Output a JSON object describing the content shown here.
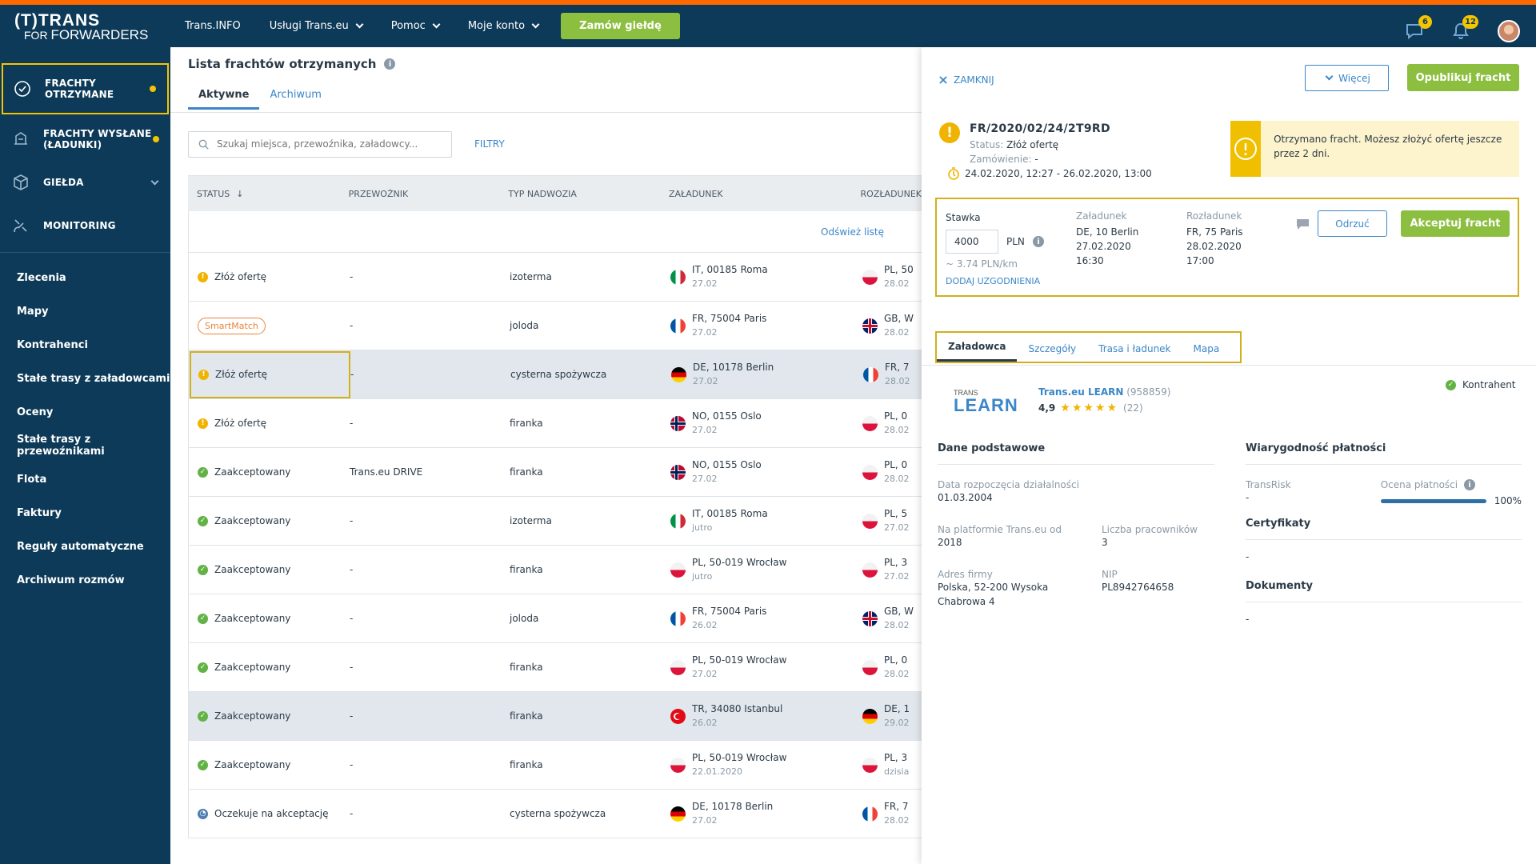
{
  "brand": {
    "line1": "(T)TRANS",
    "line2a": "FOR ",
    "line2b": "FORWARDERS"
  },
  "nav": {
    "items": [
      "Trans.INFO",
      "Usługi Trans.eu",
      "Pomoc",
      "Moje konto"
    ],
    "order_button": "Zamów giełdę"
  },
  "top_right": {
    "messages_count": "6",
    "notifications_count": "12"
  },
  "sidebar": {
    "main": [
      {
        "label1": "FRACHTY",
        "label2": "OTRZYMANE",
        "icon": "freight-received-icon"
      },
      {
        "label1": "FRACHTY WYSŁANE",
        "label2": "(ŁADUNKI)",
        "icon": "freight-sent-icon"
      },
      {
        "label1": "GIEŁDA",
        "label2": "",
        "icon": "box-icon"
      },
      {
        "label1": "MONITORING",
        "label2": "",
        "icon": "satellite-icon"
      }
    ],
    "links": [
      "Zlecenia",
      "Mapy",
      "Kontrahenci",
      "Stałe trasy z załadowcami",
      "Oceny",
      "Stałe trasy z przewoźnikami",
      "Flota",
      "Faktury",
      "Reguły automatyczne",
      "Archiwum rozmów"
    ]
  },
  "list": {
    "title": "Lista frachtów otrzymanych",
    "tabs": [
      "Aktywne",
      "Archiwum"
    ],
    "search_placeholder": "Szukaj miejsca, przewoźnika, załadowcy...",
    "filters": "FILTRY",
    "columns": [
      "STATUS",
      "PRZEWOŹNIK",
      "TYP NADWOZIA",
      "ZAŁADUNEK",
      "ROZŁADUNEK"
    ],
    "refresh": "Odśwież listę",
    "rows": [
      {
        "status": "Złóż ofertę",
        "kind": "warn",
        "carrier": "-",
        "body": "izoterma",
        "from_flag": "it",
        "from": "IT, 00185 Roma",
        "from_date": "27.02",
        "to_flag": "pl",
        "to": "PL, 50",
        "to_date": "28.02"
      },
      {
        "status": "SmartMatch",
        "kind": "smart",
        "carrier": "-",
        "body": "joloda",
        "from_flag": "fr",
        "from": "FR, 75004 Paris",
        "from_date": "27.02",
        "to_flag": "gb",
        "to": "GB, W",
        "to_date": "28.02"
      },
      {
        "status": "Złóż ofertę",
        "kind": "warn",
        "carrier": "-",
        "body": "cysterna spożywcza",
        "from_flag": "de",
        "from": "DE, 10178 Berlin",
        "from_date": "27.02",
        "to_flag": "fr",
        "to": "FR, 7",
        "to_date": "28.02"
      },
      {
        "status": "Złóż ofertę",
        "kind": "warn",
        "carrier": "-",
        "body": "firanka",
        "from_flag": "no",
        "from": "NO, 0155 Oslo",
        "from_date": "27.02",
        "to_flag": "pl",
        "to": "PL, 0",
        "to_date": "28.02"
      },
      {
        "status": "Zaakceptowany",
        "kind": "ok",
        "carrier": "Trans.eu DRIVE",
        "body": "firanka",
        "from_flag": "no",
        "from": "NO, 0155 Oslo",
        "from_date": "27.02",
        "to_flag": "pl",
        "to": "PL, 0",
        "to_date": "28.02"
      },
      {
        "status": "Zaakceptowany",
        "kind": "ok",
        "carrier": "-",
        "body": "izoterma",
        "from_flag": "it",
        "from": "IT, 00185 Roma",
        "from_date": "jutro",
        "to_flag": "pl",
        "to": "PL, 5",
        "to_date": "27.02"
      },
      {
        "status": "Zaakceptowany",
        "kind": "ok",
        "carrier": "-",
        "body": "firanka",
        "from_flag": "pl",
        "from": "PL, 50-019 Wrocław",
        "from_date": "jutro",
        "to_flag": "pl",
        "to": "PL, 3",
        "to_date": "27.02"
      },
      {
        "status": "Zaakceptowany",
        "kind": "ok",
        "carrier": "-",
        "body": "joloda",
        "from_flag": "fr",
        "from": "FR, 75004 Paris",
        "from_date": "26.02",
        "to_flag": "gb",
        "to": "GB, W",
        "to_date": "28.02"
      },
      {
        "status": "Zaakceptowany",
        "kind": "ok",
        "carrier": "-",
        "body": "firanka",
        "from_flag": "pl",
        "from": "PL, 50-019 Wrocław",
        "from_date": "27.02",
        "to_flag": "pl",
        "to": "PL, 0",
        "to_date": "28.02"
      },
      {
        "status": "Zaakceptowany",
        "kind": "ok",
        "carrier": "-",
        "body": "firanka",
        "from_flag": "tr",
        "from": "TR, 34080 Istanbul",
        "from_date": "26.02",
        "to_flag": "de",
        "to": "DE, 1",
        "to_date": "29.02"
      },
      {
        "status": "Zaakceptowany",
        "kind": "ok",
        "carrier": "-",
        "body": "firanka",
        "from_flag": "pl",
        "from": "PL, 50-019 Wrocław",
        "from_date": "22.01.2020",
        "to_flag": "pl",
        "to": "PL, 3",
        "to_date": "dzisia"
      },
      {
        "status": "Oczekuje na akceptację",
        "kind": "clock",
        "carrier": "-",
        "body": "cysterna spożywcza",
        "from_flag": "de",
        "from": "DE, 10178 Berlin",
        "from_date": "27.02",
        "to_flag": "fr",
        "to": "FR, 7",
        "to_date": "28.02"
      }
    ]
  },
  "panel": {
    "close": "ZAMKNIJ",
    "more": "Więcej",
    "publish": "Opublikuj fracht",
    "id": "FR/2020/02/24/2T9RD",
    "status_label": "Status:",
    "status_value": "Złóż ofertę",
    "order_label": "Zamówienie:",
    "order_value": "-",
    "dates": "24.02.2020, 12:27 - 26.02.2020, 13:00",
    "notice": "Otrzymano fracht. Możesz złożyć ofertę jeszcze przez 2 dni.",
    "offer": {
      "rate_label": "Stawka",
      "rate_value": "4000",
      "currency": "PLN",
      "per_km": "~ 3.74 PLN/km",
      "add": "DODAJ UZGODNIENIA",
      "load_label": "Załadunek",
      "load_l1": "DE, 10 Berlin",
      "load_l2": "27.02.2020",
      "load_l3": "16:30",
      "unload_label": "Rozładunek",
      "unload_l1": "FR, 75 Paris",
      "unload_l2": "28.02.2020",
      "unload_l3": "17:00",
      "reject": "Odrzuć",
      "accept": "Akceptuj fracht"
    },
    "tabs": [
      "Załadowca",
      "Szczegóły",
      "Trasa i ładunek",
      "Mapa"
    ],
    "logo_small": "TRANS",
    "logo_big": "LEARN",
    "company_name": "Trans.eu LEARN",
    "company_id": "(958859)",
    "rating": "4,9",
    "stars": "★★★★★",
    "reviews": "(22)",
    "kontrahent": "Kontrahent",
    "basic": {
      "title": "Dane podstawowe",
      "start_label": "Data rozpoczęcia działalności",
      "start_value": "01.03.2004",
      "since_label": "Na platformie Trans.eu od",
      "since_value": "2018",
      "employees_label": "Liczba pracowników",
      "employees_value": "3",
      "address_label": "Adres firmy",
      "address_l1": "Polska, 52-200 Wysoka",
      "address_l2": "Chabrowa 4",
      "nip_label": "NIP",
      "nip_value": "PL8942764658"
    },
    "payment": {
      "title": "Wiarygodność płatności",
      "transrisk_label": "TransRisk",
      "transrisk_value": "-",
      "score_label": "Ocena płatności",
      "score_value": "100%",
      "score_fraction": 1.0
    },
    "certs": {
      "title": "Certyfikaty",
      "value": "-"
    },
    "docs": {
      "title": "Dokumenty",
      "value": "-"
    }
  }
}
